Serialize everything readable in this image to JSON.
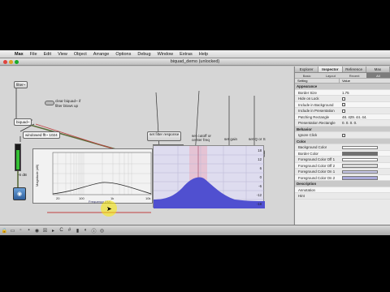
{
  "menubar": {
    "app": "Max",
    "items": [
      "File",
      "Edit",
      "View",
      "Object",
      "Arrange",
      "Options",
      "Debug",
      "Window",
      "Extras",
      "Help"
    ]
  },
  "window": {
    "title": "biquad_demo (unlocked)"
  },
  "patcher": {
    "objects": {
      "filter_msg": "filter~",
      "clear_text": "clear biquad~ if",
      "clear_text2": "filter blows up",
      "biquad": "biquad~",
      "windowed": "windowed fft~ 1024",
      "set_filter_response": "set filter response",
      "set_cutoff": "set cutoff or",
      "set_cutoff2": "center freq",
      "set_gain": "set gain",
      "set_q": "set Q or S",
      "edit_mode_label": "edit_mode",
      "edit_mode_value": "8 resonant",
      "num_cutoff": "0.",
      "num_gain": "1.0",
      "num_q": "0.",
      "level_label": "-6 dB"
    },
    "spectrum": {
      "ylabel": "Magnitude (dB)",
      "xlabel": "Frequency (Hz)",
      "xticks": [
        "20",
        "100",
        "1k",
        "10k"
      ]
    },
    "filtergraph_ticks": [
      "18",
      "12",
      "6",
      "0",
      "-6",
      "-12",
      "-18"
    ]
  },
  "inspector": {
    "tabs": [
      "Explorer",
      "Inspector",
      "Reference",
      "Max"
    ],
    "active_tab": "Inspector",
    "filters": [
      "Basic",
      "Layout",
      "Recent",
      "All"
    ],
    "active_filter": "All",
    "col_setting": "Setting",
    "col_value": "Value",
    "rows": [
      {
        "section": "Appearance"
      },
      {
        "k": "Border Size",
        "v": "1.75"
      },
      {
        "k": "Hide on Lock",
        "check": true
      },
      {
        "k": "Include in Background",
        "check": true
      },
      {
        "k": "Include in Presentation",
        "check": true
      },
      {
        "k": "Patching Rectangle",
        "v": "48. 429. 44. 44."
      },
      {
        "k": "Presentation Rectangle",
        "v": "0. 0. 0. 0."
      },
      {
        "section": "Behavior"
      },
      {
        "k": "Ignore Click",
        "check": true
      },
      {
        "section": "Color"
      },
      {
        "k": "Background Color",
        "color": "#ffffff"
      },
      {
        "k": "Border Color",
        "color": "#6f6f6f"
      },
      {
        "k": "Foreground Color Off 1",
        "color": "#ffffff"
      },
      {
        "k": "Foreground Color Off 2",
        "color": "#dcdcdc"
      },
      {
        "k": "Foreground Color On 1",
        "color": "#c8c8e8"
      },
      {
        "k": "Foreground Color On 2",
        "color": "#a8a8d8"
      },
      {
        "section": "Description"
      },
      {
        "k": "Annotation",
        "v": ""
      },
      {
        "k": "Hint",
        "v": ""
      }
    ]
  },
  "colors": {
    "patch_cord": "#333333",
    "signal_cord": "#5a6c3a",
    "selection": "#c04040",
    "curve": "#3a3acc",
    "band_highlight": "#e8a8b8"
  }
}
